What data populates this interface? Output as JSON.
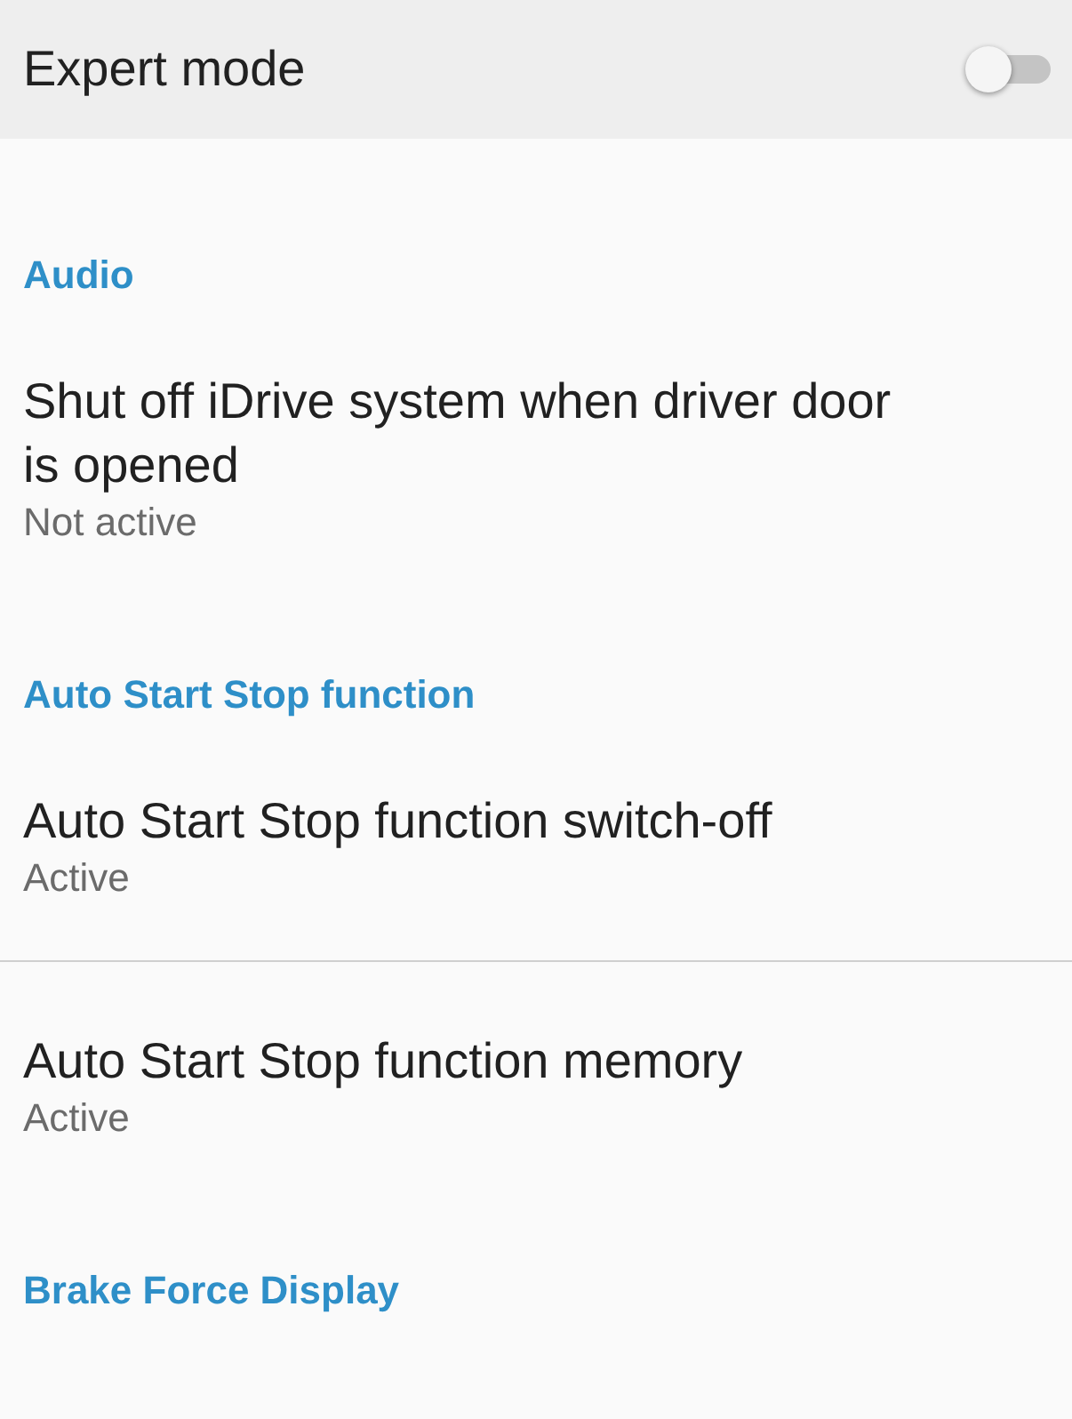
{
  "header": {
    "title": "Expert mode",
    "toggle": {
      "on": false
    }
  },
  "sections": [
    {
      "title": "Audio",
      "items": [
        {
          "title": "Shut off iDrive system when driver door is opened",
          "summary": "Not active",
          "divider": false
        }
      ]
    },
    {
      "title": "Auto Start Stop function",
      "items": [
        {
          "title": "Auto Start Stop function switch-off",
          "summary": "Active",
          "divider": true
        },
        {
          "title": "Auto Start Stop function memory",
          "summary": "Active",
          "divider": false
        }
      ]
    },
    {
      "title": "Brake Force Display"
    }
  ]
}
